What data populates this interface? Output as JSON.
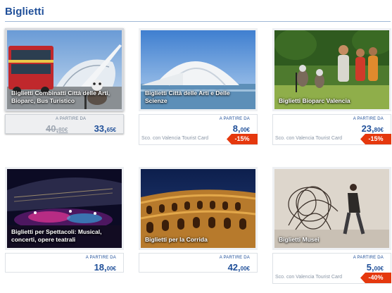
{
  "section": {
    "title": "Biglietti"
  },
  "cards": [
    {
      "title": "Biglietti Combinatti Città delle Arti, Bioparc, Bus Turistico",
      "from_label": "A PARTIRE DA",
      "old_price": {
        "int": "40,",
        "dec": "80€"
      },
      "price": {
        "int": "33,",
        "dec": "65€"
      }
    },
    {
      "title": "Biglietti Città delle Arti e Delle Scienze",
      "from_label": "A PARTIRE DA",
      "price": {
        "int": "8,",
        "dec": "00€"
      },
      "discount_text": "Sco. con Valencia Tourist Card",
      "discount_badge": "-15%"
    },
    {
      "title": "Biglietti Bioparc Valencia",
      "from_label": "A PARTIRE DA",
      "price": {
        "int": "23,",
        "dec": "80€"
      },
      "discount_text": "Sco. con Valencia Tourist Card",
      "discount_badge": "-15%"
    },
    {
      "title": "Biglietti per Spettacoli: Musical, concerti, opere teatrali",
      "from_label": "A PARTIRE DA",
      "price": {
        "int": "18,",
        "dec": "00€"
      }
    },
    {
      "title": "Biglietti per la Corrida",
      "from_label": "A PARTIRE DA",
      "price": {
        "int": "42,",
        "dec": "00€"
      }
    },
    {
      "title": "Biglietti Musei",
      "from_label": "A PARTIRE DA",
      "price": {
        "int": "5,",
        "dec": "00€"
      },
      "discount_text": "Sco. con Valencia Tourist Card",
      "discount_badge": "-40%"
    }
  ]
}
